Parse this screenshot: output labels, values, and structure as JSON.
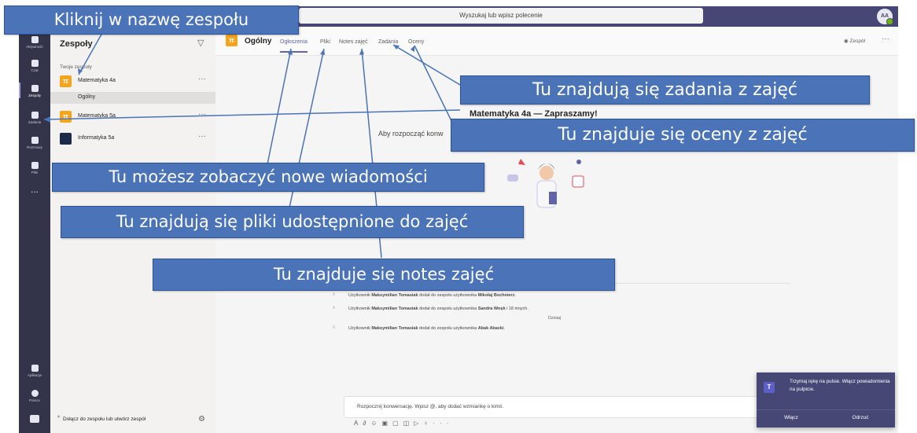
{
  "top_bar": {
    "search_placeholder": "Wyszukaj lub wpisz polecenie",
    "avatar_initials": "AA"
  },
  "rail": {
    "items": [
      {
        "label": "Aktywność",
        "icon": "bell-icon"
      },
      {
        "label": "Czat",
        "icon": "chat-icon"
      },
      {
        "label": "Zespoły",
        "icon": "teams-icon"
      },
      {
        "label": "Zadania",
        "icon": "assignments-icon"
      },
      {
        "label": "Rozmowy",
        "icon": "phone-icon"
      },
      {
        "label": "Pliki",
        "icon": "file-icon"
      }
    ],
    "more": "...",
    "apps_label": "Aplikacje",
    "help_label": "Pomoc"
  },
  "panel": {
    "title": "Zespoły",
    "section_label": "Twoje zespoły",
    "teams": [
      {
        "name": "Matematyka 4a",
        "tile": "π",
        "color": "#f7a41d"
      },
      {
        "name": "Matematyka 5a",
        "tile": "π",
        "color": "#f7a41d"
      },
      {
        "name": "Informatyka 5a",
        "tile": "",
        "color": "#1b2a4a"
      }
    ],
    "channel": "Ogólny",
    "more": "···",
    "join_label": "Dołącz do zespołu lub utwórz zespół"
  },
  "channel": {
    "tile": "π",
    "name": "Ogólny",
    "tabs": [
      "Ogłoszenia",
      "Pliki",
      "Notes zajęć",
      "Zadania",
      "Oceny"
    ],
    "team_button": "Zespół",
    "more": "···",
    "welcome": "Matematyka 4a — Zapraszamy!",
    "start_text": "Aby rozpocząć konw"
  },
  "activity": [
    {
      "pre": "Użytkownik ",
      "actor": "Maksymilian Tomasiak",
      "mid": " dodał do zespołu użytkownika ",
      "target": "Mikołaj Bochnierz",
      "post": "."
    },
    {
      "pre": "Użytkownik ",
      "actor": "Maksymilian Tomasiak",
      "mid": " dodał do zespołu użytkownika ",
      "target": "Sandra Wnęk",
      "post": " i 18 innych."
    },
    {
      "pre": "Użytkownik ",
      "actor": "Maksymilian Tomasiak",
      "mid": " dodał do zespołu użytkownika ",
      "target": "Abak Abacki",
      "post": "."
    }
  ],
  "today_label": "Dzisiaj",
  "compose": {
    "placeholder": "Rozpocznij konwersację. Wpisz @, aby dodać wzmiankę o kimś."
  },
  "toast": {
    "text": "Trzymaj rękę na pulsie. Włącz powiadomienia na pulpicie.",
    "accept": "Włącz",
    "dismiss": "Odrzuć"
  },
  "annotations": {
    "click_team": "Kliknij w nazwę zespołu",
    "assignments": "Tu znajdują się zadania z zajęć",
    "grades": "Tu znajduje się oceny z  zajęć",
    "new_messages": "Tu możesz zobaczyć nowe wiadomości",
    "files": "Tu znajdują się pliki udostępnione do zajęć",
    "notes": "Tu znajduje się notes zajęć"
  },
  "colors": {
    "rail": "#33344a",
    "topbar": "#464775",
    "accent": "#6264a7",
    "callout": "#4a73b8"
  }
}
